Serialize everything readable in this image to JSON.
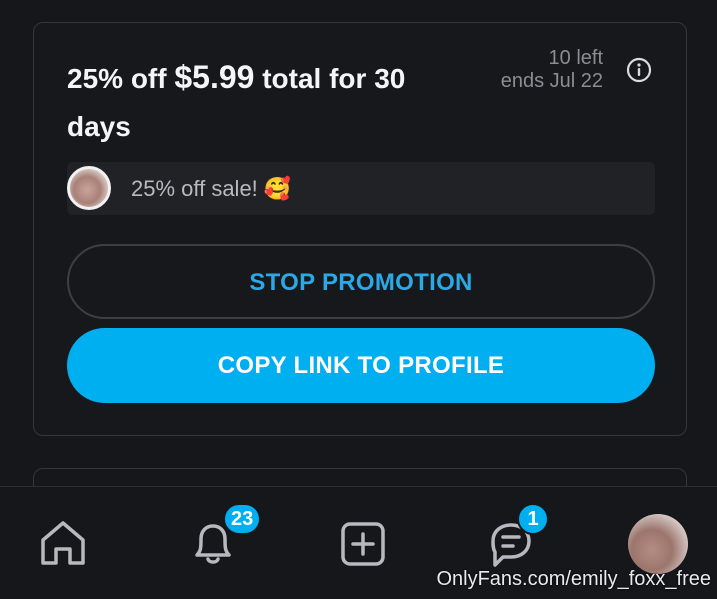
{
  "promo": {
    "title_prefix": "25% off ",
    "price": "$5.99",
    "title_suffix": " total for 30 days",
    "left_count": "10 left",
    "ends": "ends Jul 22",
    "message": "25% off sale! 🥰",
    "stop_button": "STOP PROMOTION",
    "copy_button": "COPY LINK TO PROFILE"
  },
  "nav": {
    "items": [
      {
        "icon": "home-icon"
      },
      {
        "icon": "bell-icon",
        "badge": "23"
      },
      {
        "icon": "add-post-icon"
      },
      {
        "icon": "message-icon",
        "badge": "1"
      },
      {
        "icon": "avatar"
      }
    ]
  },
  "watermark": "OnlyFans.com/emily_foxx_free",
  "colors": {
    "background": "#16171b",
    "accent": "#00aff0",
    "stop_text": "#2aa9e6"
  }
}
